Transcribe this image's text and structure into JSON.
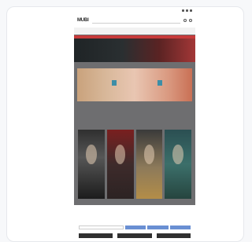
{
  "app": {
    "status": {
      "time": "",
      "icons": [
        "signal-icon",
        "wifi-icon",
        "battery-icon"
      ]
    },
    "header": {
      "logo": "MUBI",
      "search_placeholder": "",
      "icons": [
        "user-icon",
        "cart-icon"
      ]
    },
    "nav": {
      "items": [
        "",
        "",
        "",
        "",
        "",
        "",
        "",
        ""
      ]
    },
    "banners": {
      "tag_left": "",
      "tag_right": ""
    },
    "sections": {
      "movies_title": "",
      "movies_sub": "",
      "second_title": "",
      "second_sub": ""
    },
    "posters": [
      {
        "caption": ""
      },
      {
        "caption": ""
      },
      {
        "caption": ""
      },
      {
        "caption": ""
      }
    ],
    "cookie_bar": {
      "placeholder": "",
      "buttons": [
        "",
        "",
        ""
      ]
    }
  },
  "colors": {
    "accent": "#c73a3a",
    "tag": "#3d8ea7",
    "button": "#6a8fd3"
  }
}
